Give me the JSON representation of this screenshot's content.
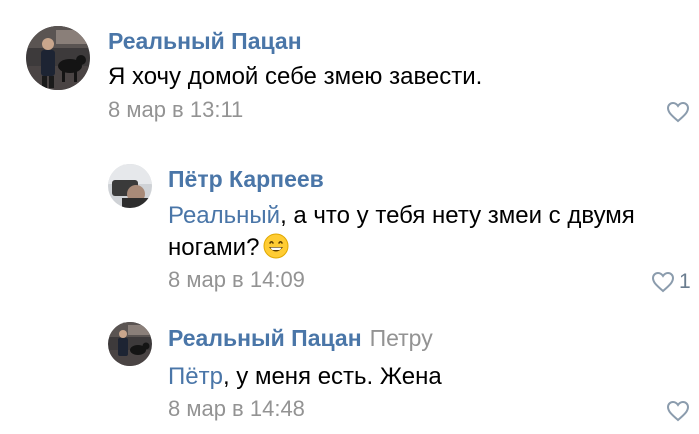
{
  "comments": [
    {
      "author": "Реальный Пацан",
      "reply_to": "",
      "mention": "",
      "text": "Я хочу домой себе змею завести.",
      "date": "8 мар в 13:11",
      "likes": ""
    },
    {
      "author": "Пётр Карпеев",
      "reply_to": "",
      "mention": "Реальный",
      "text_line1": ", а что у тебя нету змеи с двумя",
      "text_line2": "ногами?",
      "emoji": "grinning-face",
      "date": "8 мар в 14:09",
      "likes": "1"
    },
    {
      "author": "Реальный Пацан",
      "reply_to": "Петру",
      "mention": "Пётр",
      "text": ", у меня есть. Жена",
      "date": "8 мар в 14:48",
      "likes": ""
    }
  ],
  "colors": {
    "author": "#4a76a8",
    "meta": "#939393",
    "text": "#000000",
    "heart": "#8b9cad"
  },
  "icons": {
    "like": "heart-outline-icon",
    "emoji": "grinning-face-emoji-icon"
  }
}
